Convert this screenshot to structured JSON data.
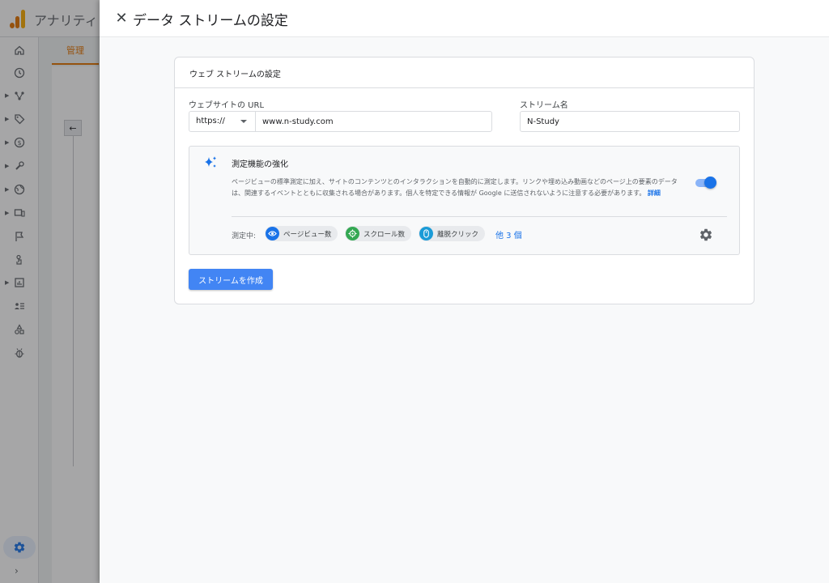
{
  "background_app": {
    "title": "アナリティ",
    "tab_label": "管理",
    "back_arrow": "←",
    "rail_icons": [
      "home-icon",
      "clock-icon",
      "explore-icon",
      "tag-icon",
      "dollar-icon",
      "wrench-icon",
      "globe-icon",
      "devices-icon",
      "flag-icon",
      "touch-icon",
      "report-icon",
      "people-list-icon",
      "shapes-icon",
      "bug-icon"
    ],
    "active_rail_icon": "settings-gear-icon",
    "expand": "›"
  },
  "panel": {
    "close_icon": "✕",
    "title": "データ ストリームの設定"
  },
  "card": {
    "title": "ウェブ ストリームの設定",
    "url_label": "ウェブサイトの URL",
    "protocol": "https://",
    "url_value": "www.n-study.com",
    "stream_name_label": "ストリーム名",
    "stream_name_value": "N-Study",
    "enhanced_measurement": {
      "title": "測定機能の強化",
      "description": "ページビューの標準測定に加え、サイトのコンテンツとのインタラクションを自動的に測定します。リンクや埋め込み動画などのページ上の要素のデータは、関連するイベントとともに収集される場合があります。個人を特定できる情報が Google に送信されないように注意する必要があります。",
      "details_link": "詳細",
      "toggle_on": true,
      "measuring_label": "測定中:",
      "chips": [
        {
          "label": "ページビュー数",
          "icon": "eye-icon",
          "color": "#1a73e8"
        },
        {
          "label": "スクロール数",
          "icon": "crosshair-icon",
          "color": "#34a853"
        },
        {
          "label": "離脱クリック",
          "icon": "mouse-icon",
          "color": "#1a9bd7"
        }
      ],
      "more_link": "他 3 個",
      "settings_icon": "gear-icon"
    },
    "create_button": "ストリームを作成"
  },
  "colors": {
    "accent": "#1a73e8",
    "button": "#4285f4",
    "brand_orange": "#e37400"
  }
}
